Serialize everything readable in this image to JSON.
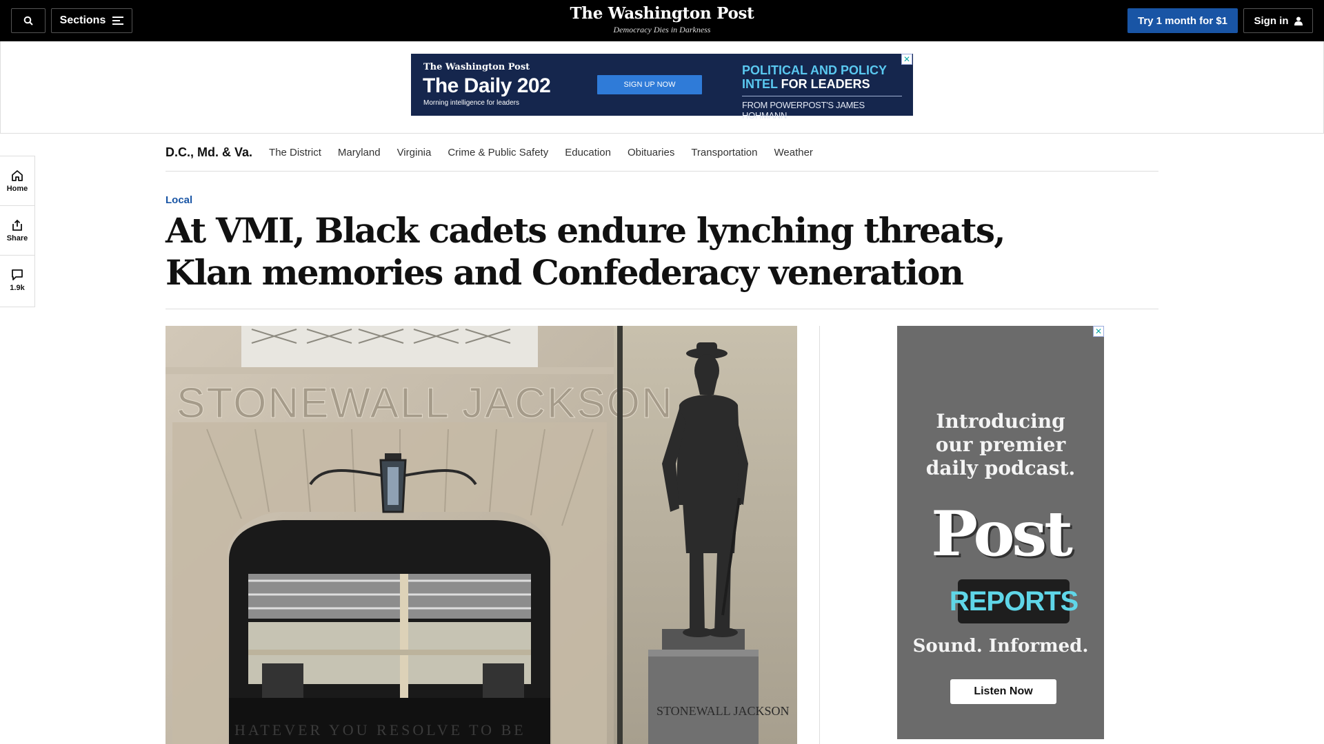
{
  "header": {
    "sections_label": "Sections",
    "logo": "The Washington Post",
    "tagline": "Democracy Dies in Darkness",
    "subscribe_label": "Try 1 month for $1",
    "signin_label": "Sign in"
  },
  "top_ad": {
    "brand": "The Washington Post",
    "title": "The Daily 202",
    "subtitle": "Morning intelligence for leaders",
    "cta": "SIGN UP NOW",
    "headline_part1": "POLITICAL AND POLICY INTEL",
    "headline_part2": " FOR LEADERS",
    "from": "FROM POWERPOST'S JAMES HOHMANN"
  },
  "section_nav": {
    "title": "D.C., Md. & Va.",
    "items": [
      "The District",
      "Maryland",
      "Virginia",
      "Crime & Public Safety",
      "Education",
      "Obituaries",
      "Transportation",
      "Weather"
    ]
  },
  "rail": {
    "home": "Home",
    "share": "Share",
    "comments": "1.9k"
  },
  "article": {
    "kicker": "Local",
    "headline": "At VMI, Black cadets endure lynching threats, Klan memories and Confederacy veneration"
  },
  "hero_image": {
    "inscription": "STONEWALL JACKSON",
    "lower_inscription": "HATEVER YOU RESOLVE TO BE",
    "plinth_inscription": "STONEWALL JACKSON"
  },
  "podcast_ad": {
    "intro_line1": "Introducing",
    "intro_line2": "our premier",
    "intro_line3": "daily podcast.",
    "brand_post": "Post",
    "brand_reports": "REPORTS",
    "tagline": "Sound. Informed.",
    "cta": "Listen Now"
  }
}
